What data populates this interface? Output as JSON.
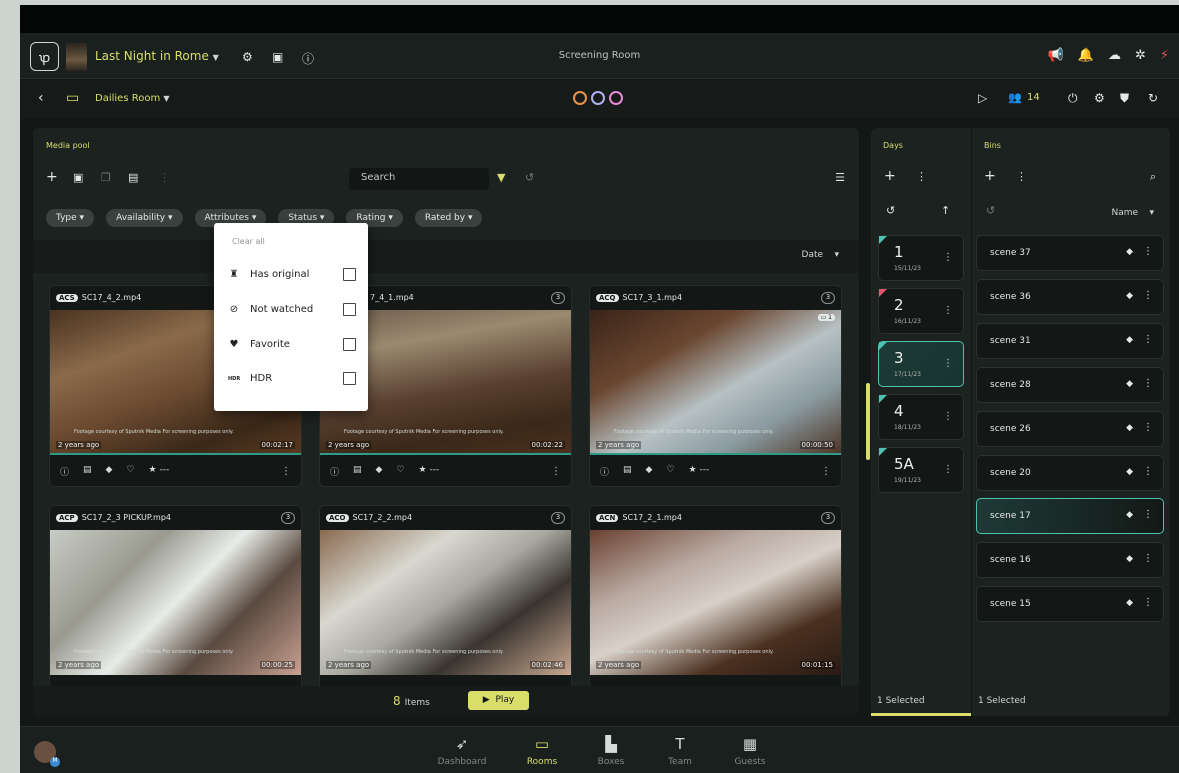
{
  "header": {
    "project_title": "Last Night in Rome",
    "center_title": "Screening Room",
    "room_title": "Dailies Room",
    "people_count": "14"
  },
  "media_pool": {
    "title": "Media pool",
    "search_placeholder": "Search",
    "filters": [
      "Type",
      "Availability",
      "Attributes",
      "Status",
      "Rating",
      "Rated by"
    ],
    "sort_label": "Date",
    "items_count": "8",
    "items_label": "Items",
    "play_label": "Play"
  },
  "attributes_menu": {
    "clear_all": "Clear all",
    "options": [
      "Has original",
      "Not watched",
      "Favorite",
      "HDR"
    ],
    "hdr_icon_text": "HDR"
  },
  "clips": [
    {
      "tag": "ACS",
      "name": "SC17_4_2.mp4",
      "count": "",
      "ago": "2 years ago",
      "duration": "00:02:17",
      "credit": "Footage courtesy of Sputnik Media For screening purposes only.",
      "rating": "★ ---"
    },
    {
      "tag": "",
      "name": "7_4_1.mp4",
      "count": "3",
      "ago": "2 years ago",
      "duration": "00:02:22",
      "credit": "Footage courtesy of Sputnik Media For screening purposes only.",
      "rating": "★ ---"
    },
    {
      "tag": "ACQ",
      "name": "SC17_3_1.mp4",
      "count": "3",
      "ago": "2 years ago",
      "duration": "00:00:50",
      "credit": "Footage courtesy of Sputnik Media For screening purposes only.",
      "rating": "★ ---",
      "comments": "1"
    },
    {
      "tag": "ACP",
      "name": "SC17_2_3 PICKUP.mp4",
      "count": "3",
      "ago": "2 years ago",
      "duration": "00:00:25",
      "credit": "Footage courtesy of Sputnik Media For screening purposes only."
    },
    {
      "tag": "ACO",
      "name": "SC17_2_2.mp4",
      "count": "3",
      "ago": "2 years ago",
      "duration": "00:02:46",
      "credit": "Footage courtesy of Sputnik Media For screening purposes only."
    },
    {
      "tag": "ACN",
      "name": "SC17_2_1.mp4",
      "count": "3",
      "ago": "2 years ago",
      "duration": "00:01:15",
      "credit": "Footage courtesy of Sputnik Media For screening purposes only."
    }
  ],
  "days": {
    "title": "Days",
    "items": [
      {
        "num": "1",
        "date": "15/11/23"
      },
      {
        "num": "2",
        "date": "16/11/23"
      },
      {
        "num": "3",
        "date": "17/11/23"
      },
      {
        "num": "4",
        "date": "18/11/23"
      },
      {
        "num": "5A",
        "date": "19/11/23"
      }
    ],
    "selected_label": "1 Selected"
  },
  "bins": {
    "title": "Bins",
    "sort_label": "Name",
    "items": [
      "scene 37",
      "scene 36",
      "scene 31",
      "scene 28",
      "scene 26",
      "scene 20",
      "scene 17",
      "scene 16",
      "scene 15"
    ],
    "selected_label": "1 Selected"
  },
  "nav": [
    "Dashboard",
    "Rooms",
    "Boxes",
    "Team",
    "Guests"
  ],
  "avatar_badge": "M",
  "colors": {
    "accent": "#d9de6a",
    "teal": "#4fc1b0",
    "bg": "#131816"
  }
}
